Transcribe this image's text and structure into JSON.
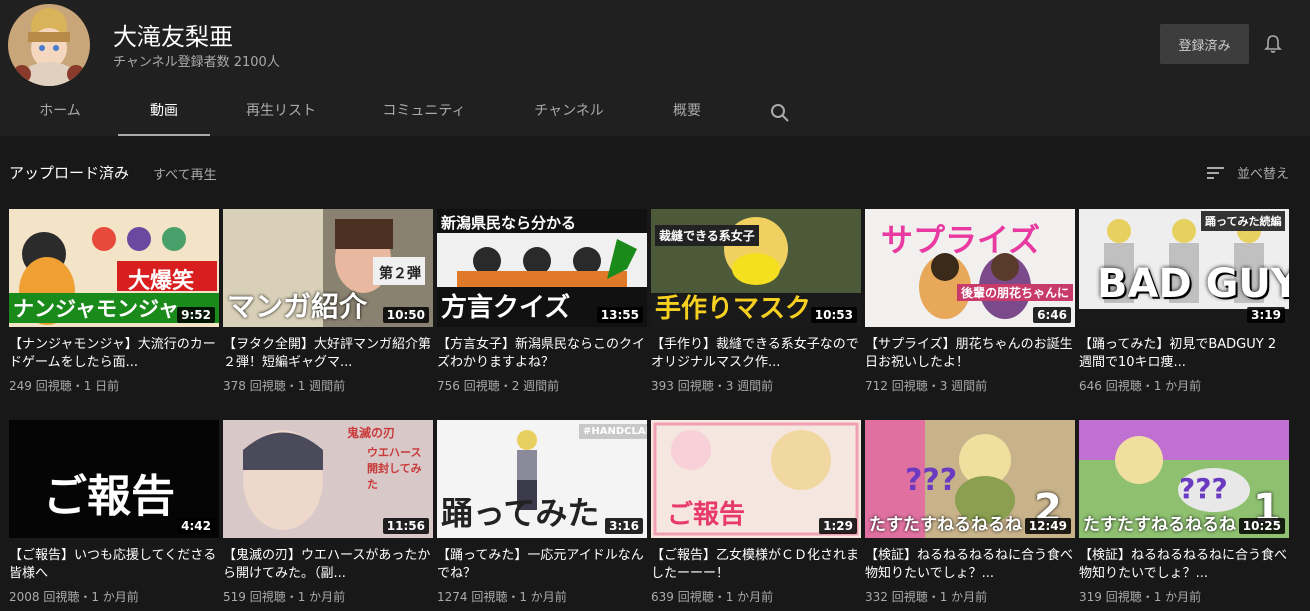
{
  "channel": {
    "name": "大滝友梨亜",
    "subscribers": "チャンネル登録者数 2100人",
    "subscribed_label": "登録済み"
  },
  "tabs": [
    {
      "label": "ホーム"
    },
    {
      "label": "動画"
    },
    {
      "label": "再生リスト"
    },
    {
      "label": "コミュニティ"
    },
    {
      "label": "チャンネル"
    },
    {
      "label": "概要"
    }
  ],
  "section": {
    "title": "アップロード済み",
    "play_all": "すべて再生",
    "sort_label": "並べ替え"
  },
  "icons": {
    "bell": "bell-icon",
    "search": "search-icon",
    "sort": "sort-icon"
  },
  "videos": [
    {
      "title": "【ナンジャモンジャ】大流行のカードゲームをしたら面...",
      "meta": "249 回視聴・1 日前",
      "duration": "9:52",
      "thumb_text": "ナンジャモンジャ",
      "thumb_text2": "大爆笑",
      "bg": "#e8a83c"
    },
    {
      "title": "【ヲタク全開】大好評マンガ紹介第２弾！短編ギャグマ...",
      "meta": "378 回視聴・1 週間前",
      "duration": "10:50",
      "thumb_text": "マンガ紹介",
      "thumb_text2": "第２弾",
      "bg": "#8a8270"
    },
    {
      "title": "【方言女子】新潟県民ならこのクイズわかりますよね？",
      "meta": "756 回視聴・2 週間前",
      "duration": "13:55",
      "thumb_text": "方言クイズ",
      "thumb_text2": "新潟県民なら分かる",
      "bg": "#f0f0f0"
    },
    {
      "title": "【手作り】裁縫できる系女子なのでオリジナルマスク作...",
      "meta": "393 回視聴・3 週間前",
      "duration": "10:53",
      "thumb_text": "手作りマスク",
      "thumb_text2": "裁縫できる系女子",
      "bg": "#4d5a3a"
    },
    {
      "title": "【サプライズ】朋花ちゃんのお誕生日お祝いしたよ！",
      "meta": "712 回視聴・3 週間前",
      "duration": "6:46",
      "thumb_text": "後輩の朋花ちゃんに",
      "thumb_text2": "サプライズ",
      "bg": "#f2f0ee"
    },
    {
      "title": "【踊ってみた】初見でBADGUY 2週間で10キロ痩...",
      "meta": "646 回視聴・1 か月前",
      "duration": "3:19",
      "thumb_text": "BAD GUY",
      "thumb_text2": "踊ってみた続編",
      "bg": "#eeeeee"
    },
    {
      "title": "【ご報告】いつも応援してくださる皆様へ",
      "meta": "2008 回視聴・1 か月前",
      "duration": "4:42",
      "thumb_text": "ご報告",
      "thumb_text2": "",
      "bg": "#050505"
    },
    {
      "title": "【鬼滅の刃】ウエハースがあったから開けてみた。（副...",
      "meta": "519 回視聴・1 か月前",
      "duration": "11:56",
      "thumb_text": "鬼滅の刃",
      "thumb_text2": "ウエハース 開封してみた",
      "bg": "#d8c8c8"
    },
    {
      "title": "【踊ってみた】一応元アイドルなんでね？",
      "meta": "1274 回視聴・1 か月前",
      "duration": "3:16",
      "thumb_text": "踊ってみた",
      "thumb_text2": "#HANDCLAP",
      "bg": "#f4f4f4"
    },
    {
      "title": "【ご報告】乙女模様がＣＤ化されましたーーー！",
      "meta": "639 回視聴・1 か月前",
      "duration": "1:29",
      "thumb_text": "ご報告",
      "thumb_text2": "",
      "bg": "#f5e6e0"
    },
    {
      "title": "【検証】ねるねるねるねに合う食べ物知りたいでしょ？...",
      "meta": "332 回視聴・1 か月前",
      "duration": "12:49",
      "thumb_text": "たすたすねるねるね",
      "thumb_text2": "2",
      "bg": "#c8b28a"
    },
    {
      "title": "【検証】ねるねるねるねに合う食べ物知りたいでしょ？...",
      "meta": "319 回視聴・1 か月前",
      "duration": "10:25",
      "thumb_text": "たすたすねるねるね",
      "thumb_text2": "1",
      "bg": "#8ec070"
    }
  ]
}
